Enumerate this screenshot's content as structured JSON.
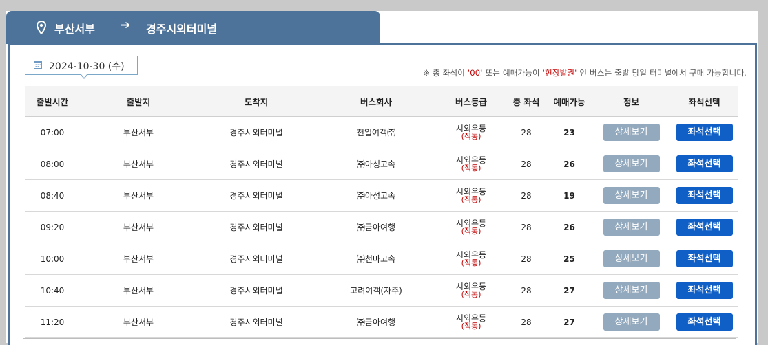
{
  "route": {
    "from": "부산서부",
    "arrow": "➔",
    "to": "경주시외터미널"
  },
  "date": "2024-10-30 (수)",
  "notice": {
    "prefix": "※ 총 좌석이 ",
    "zero": "'00'",
    "mid": " 또는 예매가능이 ",
    "onsite": "'현장발권'",
    "suffix": " 인 버스는 출발 당일 터미널에서 구매 가능합니다."
  },
  "table": {
    "headers": [
      "출발시간",
      "출발지",
      "도착지",
      "버스회사",
      "버스등급",
      "총 좌석",
      "예매가능",
      "정보",
      "좌석선택"
    ],
    "detail_label": "상세보기",
    "seat_label": "좌석선택",
    "rows": [
      {
        "time": "07:00",
        "origin": "부산서부",
        "dest": "경주시외터미널",
        "company": "천일여객㈜",
        "grade": "시외우등",
        "grade_sub": "(직통)",
        "total": "28",
        "avail": "23"
      },
      {
        "time": "08:00",
        "origin": "부산서부",
        "dest": "경주시외터미널",
        "company": "㈜아성고속",
        "grade": "시외우등",
        "grade_sub": "(직통)",
        "total": "28",
        "avail": "26"
      },
      {
        "time": "08:40",
        "origin": "부산서부",
        "dest": "경주시외터미널",
        "company": "㈜아성고속",
        "grade": "시외우등",
        "grade_sub": "(직통)",
        "total": "28",
        "avail": "19"
      },
      {
        "time": "09:20",
        "origin": "부산서부",
        "dest": "경주시외터미널",
        "company": "㈜금아여행",
        "grade": "시외우등",
        "grade_sub": "(직통)",
        "total": "28",
        "avail": "26"
      },
      {
        "time": "10:00",
        "origin": "부산서부",
        "dest": "경주시외터미널",
        "company": "㈜천마고속",
        "grade": "시외우등",
        "grade_sub": "(직통)",
        "total": "28",
        "avail": "25"
      },
      {
        "time": "10:40",
        "origin": "부산서부",
        "dest": "경주시외터미널",
        "company": "고려여객(자주)",
        "grade": "시외우등",
        "grade_sub": "(직통)",
        "total": "28",
        "avail": "27"
      },
      {
        "time": "11:20",
        "origin": "부산서부",
        "dest": "경주시외터미널",
        "company": "㈜금아여행",
        "grade": "시외우등",
        "grade_sub": "(직통)",
        "total": "28",
        "avail": "27"
      }
    ]
  },
  "colors": {
    "header_blue": "#4e739a",
    "detail_button": "#93a9bd",
    "seat_button": "#0f5fc6",
    "accent_red": "#c00000"
  },
  "icons": {
    "pin": "location-pin-icon",
    "calendar": "calendar-icon"
  }
}
